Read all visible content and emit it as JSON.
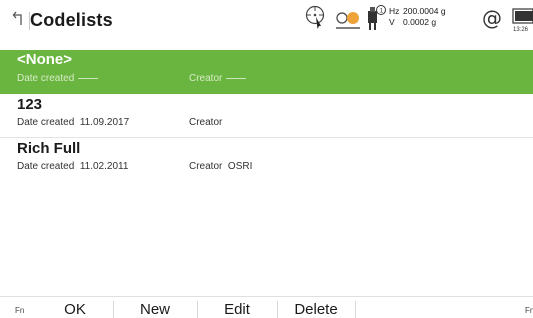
{
  "header": {
    "title": "Codelists",
    "hz_label": "Hz",
    "hz_value": "200.0004 g",
    "v_label": "V",
    "v_value": "0.0002 g",
    "at_symbol": "@",
    "time": "13:26"
  },
  "list": {
    "items": [
      {
        "title": "<None>",
        "date_label": "Date created",
        "date_value": "",
        "creator_label": "Creator",
        "creator_value": "",
        "selected": true
      },
      {
        "title": "123",
        "date_label": "Date created",
        "date_value": "11.09.2017",
        "creator_label": "Creator",
        "creator_value": "",
        "selected": false
      },
      {
        "title": "Rich Full",
        "date_label": "Date created",
        "date_value": "11.02.2011",
        "creator_label": "Creator",
        "creator_value": "OSRI",
        "selected": false
      }
    ]
  },
  "softkeys": {
    "fn_left": "Fn",
    "ok": "OK",
    "new": "New",
    "edit": "Edit",
    "delete": "Delete",
    "fn_right": "Fn"
  },
  "colors": {
    "selection": "#6ab53f"
  },
  "icons": [
    "back-icon",
    "crosshair-target-icon",
    "prism-icon",
    "instrument-face-icon",
    "at-icon",
    "battery-icon"
  ]
}
